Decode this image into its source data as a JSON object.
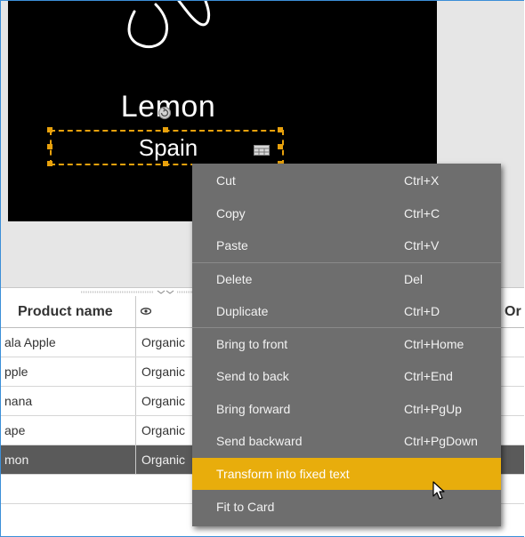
{
  "card": {
    "title": "Lemon",
    "subtitle": "Spain"
  },
  "grid": {
    "headers": {
      "product_name": "Product name",
      "visibility_icon": "eye-icon",
      "origin_partial": "Or"
    },
    "rows": [
      {
        "name": "ala Apple",
        "col2": "Organic"
      },
      {
        "name": "pple",
        "col2": "Organic"
      },
      {
        "name": "nana",
        "col2": "Organic"
      },
      {
        "name": "ape",
        "col2": "Organic"
      },
      {
        "name": "mon",
        "col2": "Organic"
      }
    ],
    "selected_row_index": 4
  },
  "context_menu": {
    "items": [
      {
        "label": "Cut",
        "shortcut": "Ctrl+X"
      },
      {
        "label": "Copy",
        "shortcut": "Ctrl+C"
      },
      {
        "label": "Paste",
        "shortcut": "Ctrl+V"
      },
      {
        "label": "Delete",
        "shortcut": "Del"
      },
      {
        "label": "Duplicate",
        "shortcut": "Ctrl+D"
      },
      {
        "label": "Bring to front",
        "shortcut": "Ctrl+Home"
      },
      {
        "label": "Send to back",
        "shortcut": "Ctrl+End"
      },
      {
        "label": "Bring forward",
        "shortcut": "Ctrl+PgUp"
      },
      {
        "label": "Send backward",
        "shortcut": "Ctrl+PgDown"
      },
      {
        "label": "Transform into fixed text",
        "shortcut": ""
      },
      {
        "label": "Fit to Card",
        "shortcut": ""
      }
    ],
    "highlighted_index": 9
  },
  "colors": {
    "accent": "#e8ad0c",
    "menu_bg": "#6e6e6e",
    "selected_row_bg": "#5a5a5a",
    "card_bg": "#000000"
  }
}
